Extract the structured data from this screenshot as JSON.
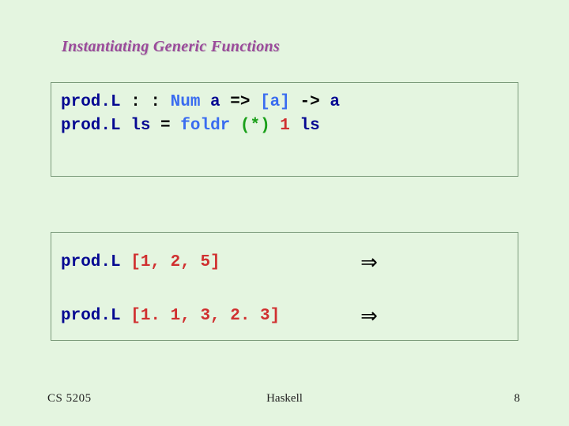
{
  "title": "Instantiating Generic Functions",
  "def": {
    "id1": "prod.L",
    "cc": " : : ",
    "num": "Num",
    "a1": " a ",
    "arr1": "=> ",
    "la": "[a]",
    "arr2": " -> ",
    "a2": "a",
    "id2": "prod.L",
    "ls1": " ls ",
    "eq": "= ",
    "foldr": "foldr",
    "sp": " ",
    "star": "(*)",
    "one": " 1 ",
    "ls2": "ls"
  },
  "ex": {
    "row1": {
      "id": "prod.L",
      "lit": " [1, 2, 5]",
      "arrow": "⇒"
    },
    "row2": {
      "id": "prod.L",
      "lit": " [1. 1, 3, 2. 3]",
      "arrow": "⇒"
    }
  },
  "footer": {
    "course": "CS 5205",
    "topic": "Haskell",
    "page": "8"
  }
}
